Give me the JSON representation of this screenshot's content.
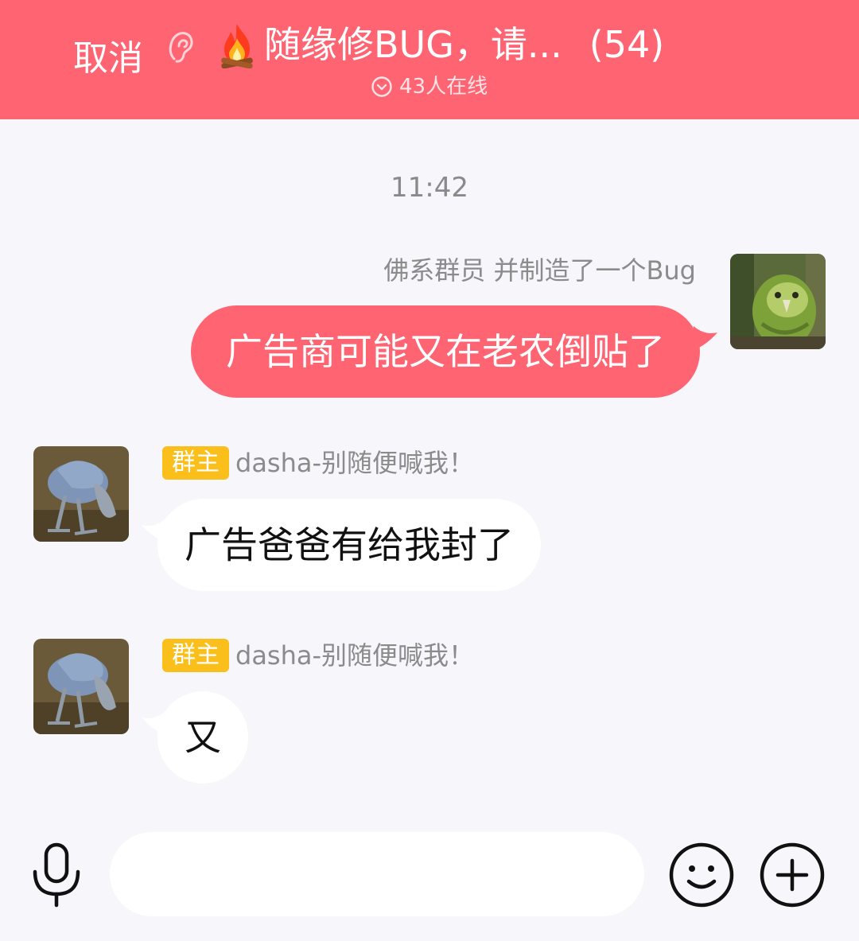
{
  "header": {
    "cancel_label": "取消",
    "ear_icon": "ear-icon",
    "fire_icon": "fire-icon",
    "group_title": "随缘修BUG，请...",
    "member_count": "(54)",
    "online_icon": "chevron-circle-icon",
    "online_status": "43人在线"
  },
  "chat": {
    "timestamp": "11:42",
    "messages": [
      {
        "direction": "outgoing",
        "sender_line": "佛系群员 并制造了一个Bug",
        "avatar_icon": "kakapo-parrot-avatar",
        "text": "广告商可能又在老农倒贴了"
      },
      {
        "direction": "incoming",
        "badge": "群主",
        "sender": "dasha-别随便喊我！",
        "avatar_icon": "shoebill-bird-avatar",
        "text": "广告爸爸有给我封了"
      },
      {
        "direction": "incoming",
        "badge": "群主",
        "sender": "dasha-别随便喊我！",
        "avatar_icon": "shoebill-bird-avatar",
        "text": "又"
      }
    ]
  },
  "input_bar": {
    "mic_icon": "microphone-icon",
    "input_value": "",
    "input_placeholder": "",
    "emoji_icon": "smiley-icon",
    "plus_icon": "plus-circle-icon"
  },
  "colors": {
    "brand": "#ff6472",
    "background": "#f6f6fb",
    "badge": "#fbbf1c"
  }
}
